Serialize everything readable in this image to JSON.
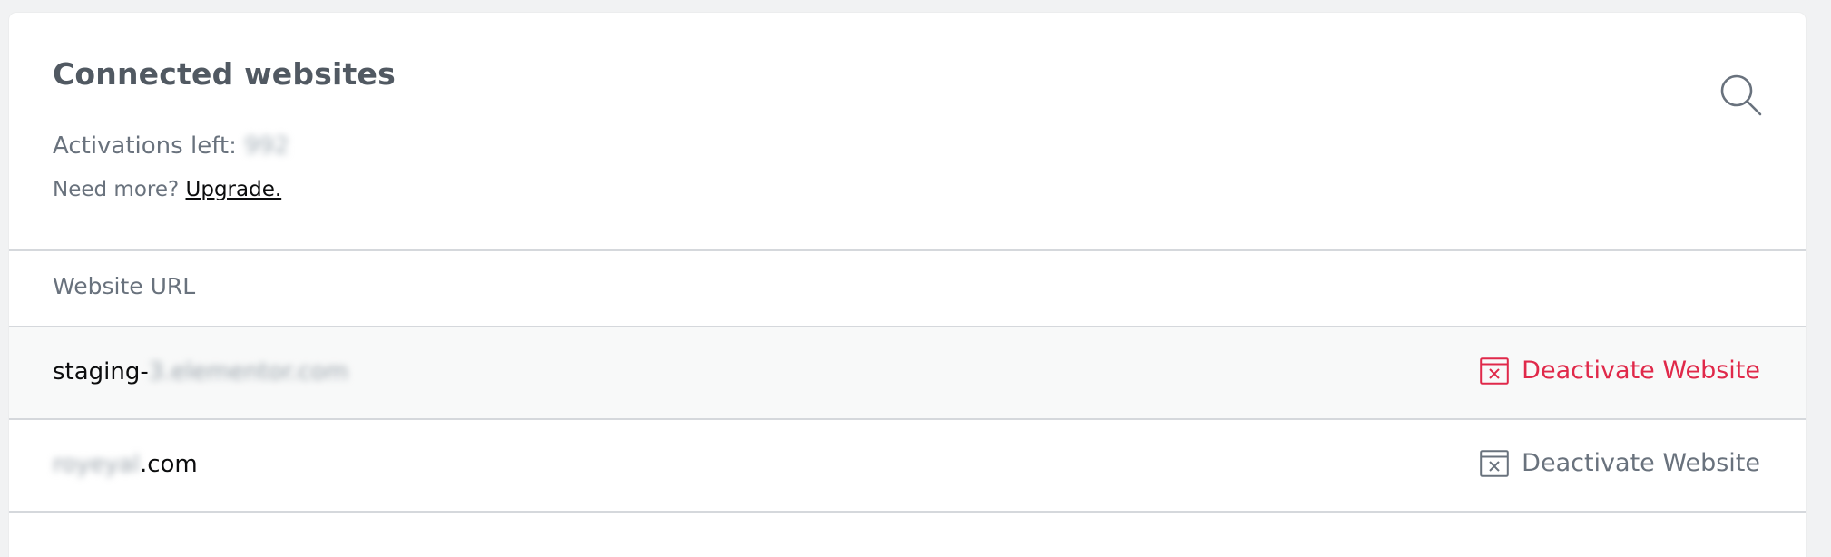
{
  "header": {
    "title": "Connected websites",
    "activations_label": "Activations left: ",
    "activations_value": "992",
    "need_more_text": "Need more? ",
    "upgrade_link": "Upgrade."
  },
  "table": {
    "column_header": "Website URL",
    "rows": [
      {
        "url_prefix": "staging-",
        "url_blurred": "3.elementor.com",
        "url_suffix": "",
        "action_label": "Deactivate Website"
      },
      {
        "url_prefix": "",
        "url_blurred": "royeyal",
        "url_suffix": ".com",
        "action_label": "Deactivate Website"
      }
    ]
  },
  "colors": {
    "accent_danger": "#e0294a",
    "text_muted": "#69727d",
    "title": "#515962"
  },
  "icons": {
    "search": "search-icon",
    "deactivate": "window-close-icon"
  }
}
